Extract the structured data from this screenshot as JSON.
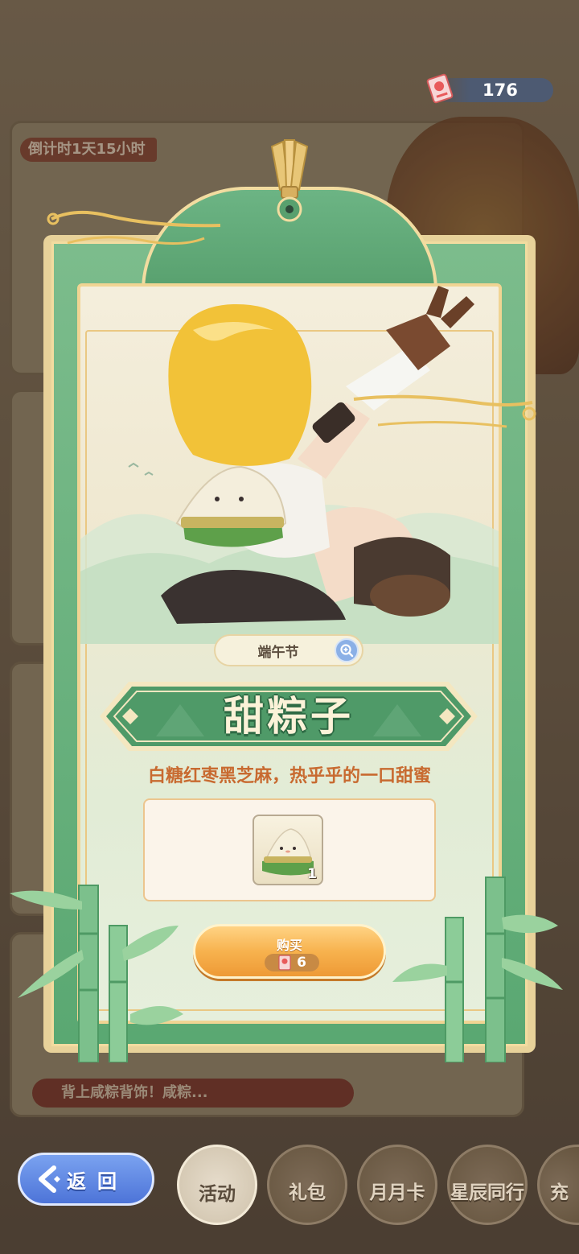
{
  "currency": {
    "icon": "ticket-icon",
    "value": "176"
  },
  "background": {
    "countdown": "倒计时1天15小时",
    "banner_text": "背上咸粽背饰！咸粽..."
  },
  "item": {
    "festival_tag": "端午节",
    "zoom_icon": "magnifier-plus-icon",
    "name": "甜粽子",
    "description": "白糖红枣黑芝麻，热乎乎的一口甜蜜",
    "reward": {
      "icon": "zongzi-icon",
      "count": "1"
    },
    "buy": {
      "label": "购买",
      "price_icon": "ticket-icon",
      "price": "6"
    }
  },
  "nav": {
    "back_label": "返回",
    "tabs": [
      {
        "label": "活动",
        "icon": "activity-icon",
        "active": true
      },
      {
        "label": "礼包",
        "icon": "gift-icon",
        "active": false
      },
      {
        "label": "月月卡",
        "icon": "monthly-card-icon",
        "active": false
      },
      {
        "label": "星辰同行",
        "icon": "star-icon",
        "active": false
      },
      {
        "label": "充",
        "icon": "recharge-icon",
        "active": false
      }
    ]
  },
  "colors": {
    "frame_green": "#5aa872",
    "frame_gold": "#f0d493",
    "title_text": "#fbf2d8",
    "desc_text": "#c86a30",
    "buy_button": "#f7b24e",
    "back_button": "#4d74d8"
  }
}
